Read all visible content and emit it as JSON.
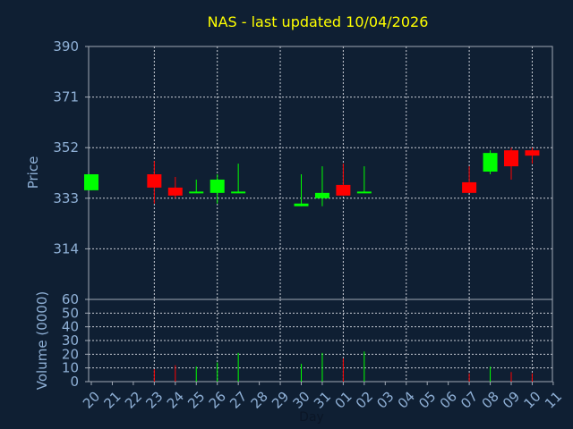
{
  "chart_data": {
    "type": "candlestick",
    "title": "NAS - last updated 10/04/2026",
    "xlabel": "Day",
    "colors": {
      "background": "#0f1f33",
      "up": "#00ff00",
      "down": "#ff0000",
      "title": "#ffff00",
      "text": "#8fb0d6",
      "grid": "#c8ccd4"
    },
    "x_ticks": [
      "20",
      "21",
      "22",
      "23",
      "24",
      "25",
      "26",
      "27",
      "28",
      "29",
      "30",
      "31",
      "01",
      "02",
      "03",
      "04",
      "05",
      "06",
      "07",
      "08",
      "09",
      "10",
      "11"
    ],
    "price_panel": {
      "ylabel": "Price",
      "ylim": [
        295,
        390
      ],
      "yticks": [
        314,
        333,
        352,
        371,
        390
      ],
      "grid": true
    },
    "volume_panel": {
      "ylabel": "Volume (0000)",
      "ylim": [
        0,
        60
      ],
      "yticks": [
        0,
        10,
        20,
        30,
        40,
        50,
        60
      ],
      "grid": true
    },
    "candles": [
      {
        "day": "20",
        "open": 336,
        "high": 342,
        "low": 336,
        "close": 342,
        "volume": 0
      },
      {
        "day": "23",
        "open": 342,
        "high": 347,
        "low": 331,
        "close": 337,
        "volume": 9
      },
      {
        "day": "24",
        "open": 337,
        "high": 341,
        "low": 333,
        "close": 334,
        "volume": 12
      },
      {
        "day": "25",
        "open": 335,
        "high": 340,
        "low": 335,
        "close": 335.5,
        "volume": 11
      },
      {
        "day": "26",
        "open": 335,
        "high": 342,
        "low": 331,
        "close": 340,
        "volume": 14
      },
      {
        "day": "27",
        "open": 335,
        "high": 346,
        "low": 335,
        "close": 335.5,
        "volume": 21
      },
      {
        "day": "30",
        "open": 330,
        "high": 342,
        "low": 330,
        "close": 331,
        "volume": 13
      },
      {
        "day": "31",
        "open": 333,
        "high": 345,
        "low": 330,
        "close": 335,
        "volume": 21
      },
      {
        "day": "01",
        "open": 338,
        "high": 346,
        "low": 334,
        "close": 334,
        "volume": 17
      },
      {
        "day": "02",
        "open": 335,
        "high": 345,
        "low": 335,
        "close": 335.5,
        "volume": 22
      },
      {
        "day": "07",
        "open": 339,
        "high": 345,
        "low": 335,
        "close": 335,
        "volume": 6
      },
      {
        "day": "08",
        "open": 343,
        "high": 351,
        "low": 342,
        "close": 350,
        "volume": 11
      },
      {
        "day": "09",
        "open": 351,
        "high": 352,
        "low": 340,
        "close": 345,
        "volume": 7
      },
      {
        "day": "10",
        "open": 351,
        "high": 352,
        "low": 346,
        "close": 349,
        "volume": 6
      }
    ]
  }
}
